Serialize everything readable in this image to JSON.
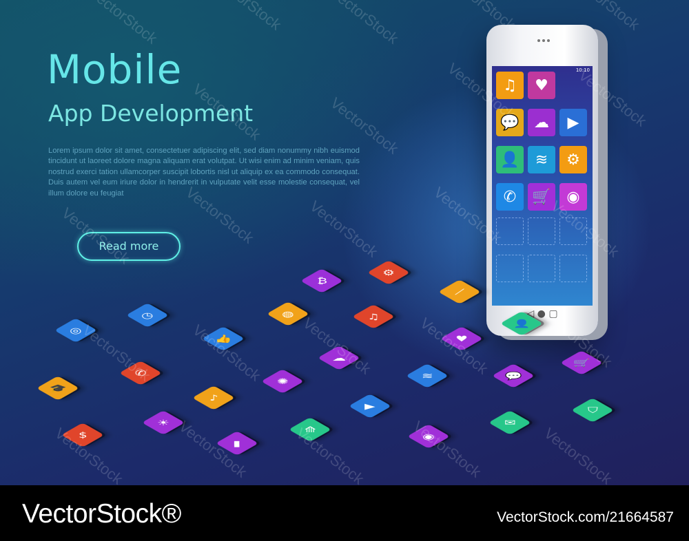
{
  "hero": {
    "title": "Mobile",
    "subtitle": "App Development",
    "body": "Lorem ipsum dolor sit amet, consectetuer adipiscing elit, sed diam nonummy nibh euismod tincidunt ut laoreet dolore magna aliquam erat volutpat. Ut wisi enim ad minim veniam, quis nostrud exerci tation ullamcorper suscipit lobortis nisl ut aliquip ex ea commodo consequat. Duis autem vel eum iriure dolor in hendrerit in vulputate velit esse molestie consequat, vel illum dolore eu feugiat",
    "button_label": "Read more"
  },
  "phone": {
    "time": "10:10",
    "apps": [
      {
        "icon": "music-icon",
        "glyph": "♫",
        "color": "#f39c12"
      },
      {
        "icon": "heart-rate-icon",
        "glyph": "♥",
        "color": "#c0399f"
      },
      {
        "icon": "chat-icon",
        "glyph": "💬",
        "color": "#e4a81b"
      },
      {
        "icon": "weather-icon",
        "glyph": "☁",
        "color": "#9b2fd0"
      },
      {
        "icon": "video-icon",
        "glyph": "▶",
        "color": "#2a6fd6"
      },
      {
        "icon": "contact-icon",
        "glyph": "👤",
        "color": "#2ebd7a"
      },
      {
        "icon": "wifi-icon",
        "glyph": "≋",
        "color": "#1e9bd8"
      },
      {
        "icon": "settings-icon",
        "glyph": "⚙",
        "color": "#f39c12"
      },
      {
        "icon": "phone-icon",
        "glyph": "✆",
        "color": "#1e88e5"
      },
      {
        "icon": "cart-icon",
        "glyph": "🛒",
        "color": "#a12fd8"
      },
      {
        "icon": "camera-icon",
        "glyph": "◉",
        "color": "#c33ad6"
      }
    ],
    "nav": "◁   ●   ▢"
  },
  "tiles": [
    {
      "icon": "bitcoin-icon",
      "glyph": "₿",
      "color": "#9b30d9"
    },
    {
      "icon": "gear-icon",
      "glyph": "⚙",
      "color": "#e0452b"
    },
    {
      "icon": "knife-icon",
      "glyph": "⟋",
      "color": "#f1a21a"
    },
    {
      "icon": "target-icon",
      "glyph": "◎",
      "color": "#2a7de0"
    },
    {
      "icon": "clock-icon",
      "glyph": "◷",
      "color": "#2a7de0"
    },
    {
      "icon": "globe-icon",
      "glyph": "◍",
      "color": "#f1a21a"
    },
    {
      "icon": "music-icon",
      "glyph": "♫",
      "color": "#e0452b"
    },
    {
      "icon": "heart-rate-icon",
      "glyph": "♥",
      "color": "#a030d8"
    },
    {
      "icon": "contact-icon",
      "glyph": "👤",
      "color": "#27c78a"
    },
    {
      "icon": "thumbs-up-icon",
      "glyph": "👍",
      "color": "#2a7de0"
    },
    {
      "icon": "weather-icon",
      "glyph": "☁",
      "color": "#a030d8"
    },
    {
      "icon": "graduation-cap-icon",
      "glyph": "🎓",
      "color": "#f1a21a"
    },
    {
      "icon": "phone-icon",
      "glyph": "✆",
      "color": "#e0452b"
    },
    {
      "icon": "brain-icon",
      "glyph": "✺",
      "color": "#a030d8"
    },
    {
      "icon": "wifi-icon",
      "glyph": "≋",
      "color": "#2a7de0"
    },
    {
      "icon": "chat-icon",
      "glyph": "💬",
      "color": "#a030d8"
    },
    {
      "icon": "cart-icon",
      "glyph": "🛒",
      "color": "#a030d8"
    },
    {
      "icon": "guitar-icon",
      "glyph": "♪",
      "color": "#f1a21a"
    },
    {
      "icon": "video-icon",
      "glyph": "▶",
      "color": "#2a7de0"
    },
    {
      "icon": "shield-icon",
      "glyph": "⛉",
      "color": "#27c78a"
    },
    {
      "icon": "money-icon",
      "glyph": "$",
      "color": "#e0452b"
    },
    {
      "icon": "sun-icon",
      "glyph": "☀",
      "color": "#a030d8"
    },
    {
      "icon": "battery-icon",
      "glyph": "▮",
      "color": "#a030d8"
    },
    {
      "icon": "road-icon",
      "glyph": "⟰",
      "color": "#27c78a"
    },
    {
      "icon": "camera-icon",
      "glyph": "◉",
      "color": "#a030d8"
    },
    {
      "icon": "mail-icon",
      "glyph": "✉",
      "color": "#27c78a"
    }
  ],
  "watermark": "VectorStock",
  "footer": {
    "brand": "VectorStock®",
    "url": "VectorStock.com/21664587"
  }
}
